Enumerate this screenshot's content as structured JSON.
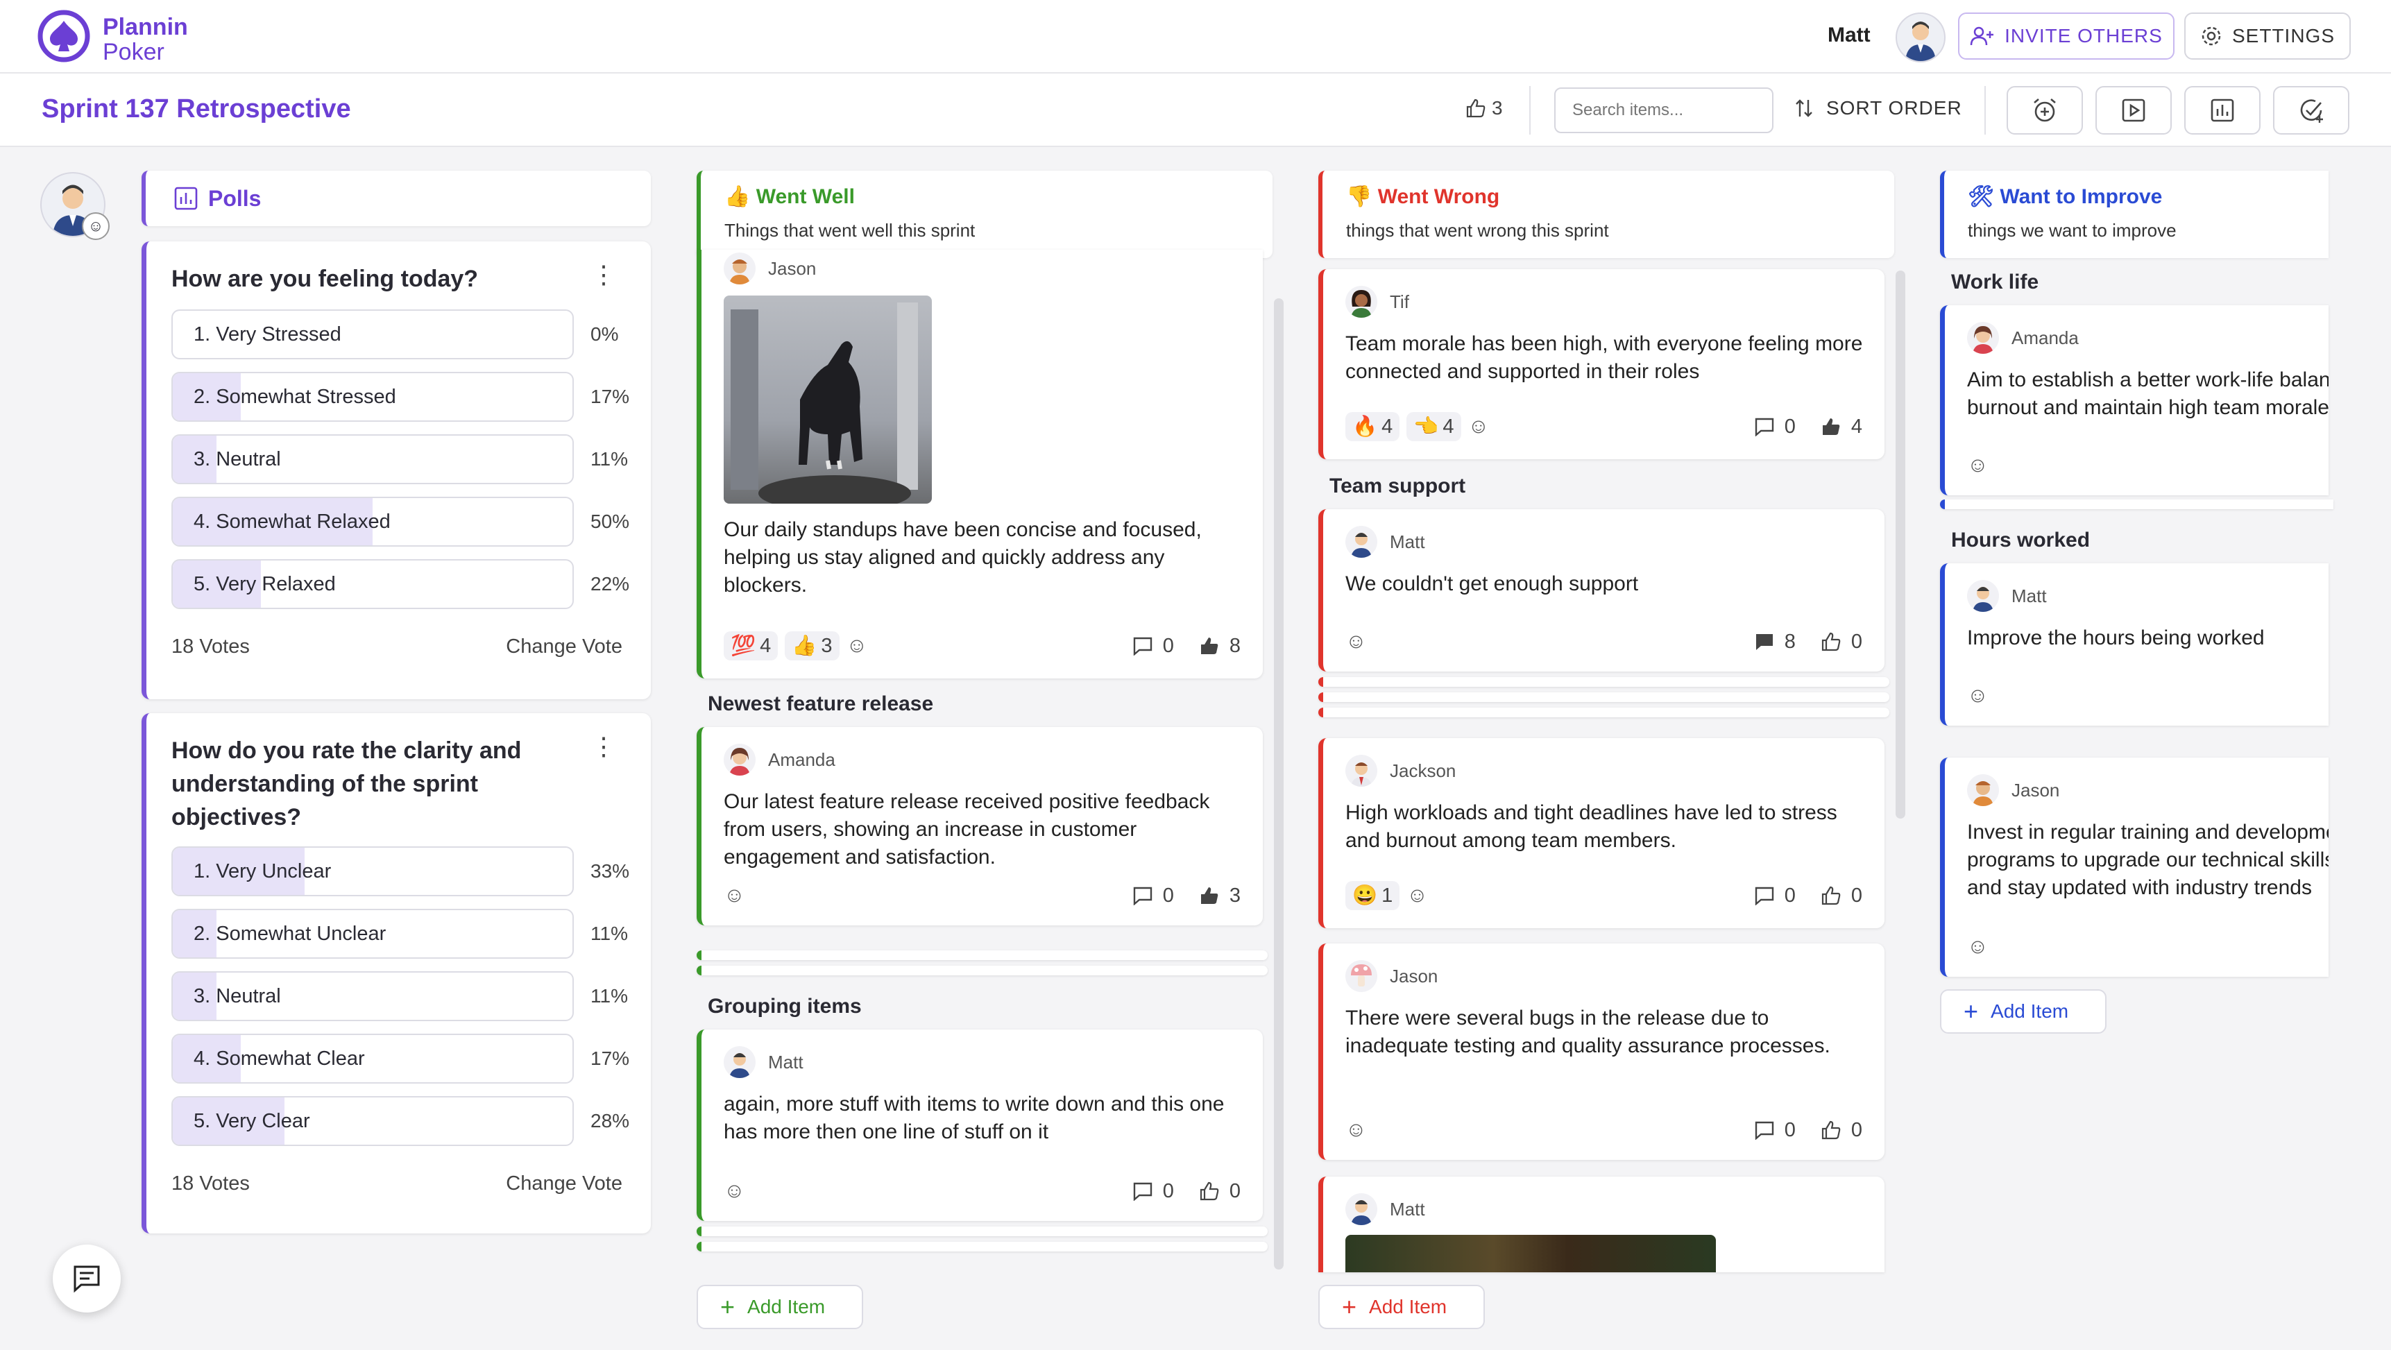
{
  "app": {
    "logo_line1": "Plannin",
    "logo_line2": "Poker",
    "user_name": "Matt",
    "invite_label": "INVITE OTHERS",
    "settings_label": "SETTINGS"
  },
  "board": {
    "title": "Sprint 137 Retrospective",
    "like_count": "3",
    "search_placeholder": "Search items...",
    "sort_label": "SORT ORDER"
  },
  "colors": {
    "accent": "#6b3fd4",
    "went_well": "#3a9a2a",
    "went_wrong": "#e0342c",
    "improve": "#2a4bd4"
  },
  "polls": {
    "header": "Polls",
    "items": [
      {
        "question": "How are you feeling today?",
        "options": [
          {
            "label": "1. Very Stressed",
            "pct": "0%",
            "value": 0
          },
          {
            "label": "2. Somewhat Stressed",
            "pct": "17%",
            "value": 17
          },
          {
            "label": "3. Neutral",
            "pct": "11%",
            "value": 11
          },
          {
            "label": "4. Somewhat Relaxed",
            "pct": "50%",
            "value": 50
          },
          {
            "label": "5. Very Relaxed",
            "pct": "22%",
            "value": 22
          }
        ],
        "votes": "18 Votes",
        "change": "Change Vote"
      },
      {
        "question": "How do you rate the clarity and understanding of the sprint objectives?",
        "options": [
          {
            "label": "1. Very Unclear",
            "pct": "33%",
            "value": 33
          },
          {
            "label": "2. Somewhat Unclear",
            "pct": "11%",
            "value": 11
          },
          {
            "label": "3. Neutral",
            "pct": "11%",
            "value": 11
          },
          {
            "label": "4. Somewhat Clear",
            "pct": "17%",
            "value": 17
          },
          {
            "label": "5. Very Clear",
            "pct": "28%",
            "value": 28
          }
        ],
        "votes": "18 Votes",
        "change": "Change Vote"
      }
    ]
  },
  "went_well": {
    "header": "👍 Went Well",
    "subtitle": "Things that went well this sprint",
    "card1": {
      "author": "Jason",
      "text": "Our daily standups have been concise and focused, helping us stay aligned and quickly address any blockers.",
      "r1": "💯",
      "r1c": "4",
      "r2": "👍",
      "r2c": "3",
      "comments": "0",
      "likes": "8"
    },
    "group1": "Newest feature release",
    "card2": {
      "author": "Amanda",
      "text": "Our latest feature release received positive feedback from users, showing an increase in customer engagement and satisfaction.",
      "comments": "0",
      "likes": "3"
    },
    "group2": "Grouping items",
    "card3": {
      "author": "Matt",
      "text": "again, more stuff with items to write down and this one has more then one line of stuff on it",
      "comments": "0",
      "likes": "0"
    },
    "add": "Add Item"
  },
  "went_wrong": {
    "header": "👎 Went Wrong",
    "subtitle": "things that went wrong this sprint",
    "card1": {
      "author": "Tif",
      "text": "Team morale has been high, with everyone feeling more connected and supported in their roles",
      "r1": "🔥",
      "r1c": "4",
      "r2": "👈",
      "r2c": "4",
      "comments": "0",
      "likes": "4"
    },
    "group1": "Team support",
    "card2": {
      "author": "Matt",
      "text": "We couldn't get enough support",
      "comments": "8",
      "likes": "0"
    },
    "card3": {
      "author": "Jackson",
      "text": "High workloads and tight deadlines have led to stress and burnout among team members.",
      "r1": "😀",
      "r1c": "1",
      "comments": "0",
      "likes": "0"
    },
    "card4": {
      "author": "Jason",
      "text": "There were several bugs in the release due to inadequate testing and quality assurance processes.",
      "comments": "0",
      "likes": "0"
    },
    "card5": {
      "author": "Matt"
    },
    "add": "Add Item"
  },
  "improve": {
    "header": "🛠 Want to Improve",
    "subtitle": "things we want to improve",
    "group1": "Work life",
    "card1": {
      "author": "Amanda",
      "text": "Aim to establish a better work-life balance to prevent burnout and maintain high team morale"
    },
    "group2": "Hours worked",
    "card2": {
      "author": "Matt",
      "text": "Improve the hours being worked"
    },
    "card3": {
      "author": "Jason",
      "text": "Invest in regular training and development programs to upgrade our technical skills and stay updated with industry trends"
    },
    "add": "Add Item"
  }
}
